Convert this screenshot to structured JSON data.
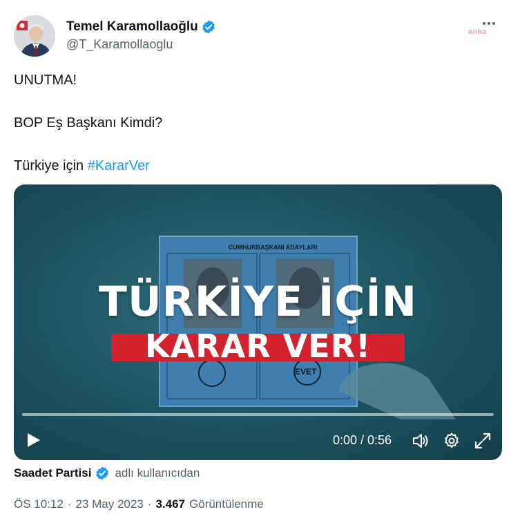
{
  "author": {
    "display_name": "Temel Karamollaoğlu",
    "handle": "@T_Karamollaoglu",
    "verified": true
  },
  "watermark": "anka",
  "tweet": {
    "lines": [
      "UNUTMA!",
      "BOP Eş Başkanı Kimdi?"
    ],
    "last_line_prefix": "Türkiye için ",
    "hashtag": "#KararVer"
  },
  "video": {
    "ballot_title": "CUMHURBAŞKANI ADAYLARI",
    "ballot_stamp": "EVET",
    "overlay_line1": "TÜRKİYE İÇİN",
    "overlay_line2": "KARAR VER!",
    "time_display": "0:00 / 0:56",
    "progress": 0,
    "colors": {
      "band": "#d2222d",
      "ballot": "#3f7fb0"
    }
  },
  "source": {
    "name": "Saadet Partisi",
    "verified": true,
    "suffix": "adlı kullanıcıdan"
  },
  "meta": {
    "time": "ÖS 10:12",
    "separator": "·",
    "date": "23 May 2023",
    "views_count": "3.467",
    "views_label": "Görüntülenme"
  },
  "colors": {
    "accent": "#1d9bf0",
    "secondary_text": "#536471",
    "primary_text": "#0f1419"
  }
}
